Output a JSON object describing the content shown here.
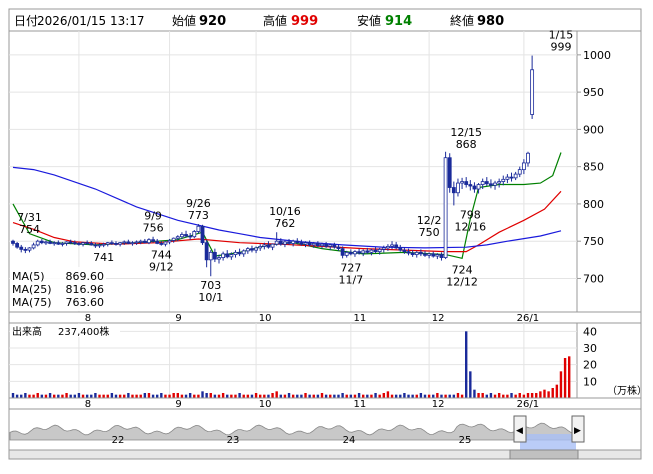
{
  "header": {
    "date_label": "日付",
    "date": "2026/01/15 13:17",
    "open_label": "始値",
    "open": "920",
    "high_label": "高値",
    "high": "999",
    "low_label": "安値",
    "low": "914",
    "close_label": "終値",
    "close": "980",
    "colors": {
      "high": "#e00000",
      "low": "#008000",
      "normal": "#000000"
    }
  },
  "chart_data": {
    "type": "candlestick",
    "price_axis": {
      "ticks": [
        700,
        750,
        800,
        850,
        900,
        950,
        1000
      ],
      "range": [
        655,
        1032
      ]
    },
    "x_axis_months": [
      "8",
      "9",
      "10",
      "11",
      "12",
      "26/1"
    ],
    "month_starts": [
      16,
      38,
      59,
      82,
      101,
      124
    ],
    "annotations": [
      {
        "i": 4,
        "price": 754,
        "date": "7/31",
        "value": "754",
        "pos": "above"
      },
      {
        "i": 22,
        "price": 741,
        "date": "",
        "value": "741",
        "pos": "below-partial"
      },
      {
        "i": 34,
        "price": 756,
        "date": "9/9",
        "value": "756",
        "pos": "above"
      },
      {
        "i": 36,
        "price": 744,
        "date": "9/12",
        "value": "744",
        "pos": "below"
      },
      {
        "i": 45,
        "price": 773,
        "date": "9/26",
        "value": "773",
        "pos": "above"
      },
      {
        "i": 48,
        "price": 703,
        "date": "10/1",
        "value": "703",
        "pos": "below"
      },
      {
        "i": 66,
        "price": 762,
        "date": "10/16",
        "value": "762",
        "pos": "above"
      },
      {
        "i": 82,
        "price": 727,
        "date": "11/7",
        "value": "727",
        "pos": "below"
      },
      {
        "i": 101,
        "price": 750,
        "date": "12/2",
        "value": "750",
        "pos": "above"
      },
      {
        "i": 109,
        "price": 724,
        "date": "12/12",
        "value": "724",
        "pos": "below"
      },
      {
        "i": 110,
        "price": 868,
        "date": "12/15",
        "value": "868",
        "pos": "above"
      },
      {
        "i": 111,
        "price": 798,
        "date": "12/16",
        "value": "798",
        "pos": "below"
      },
      {
        "i": 133,
        "price": 999,
        "date": "1/15",
        "value": "999",
        "pos": "above"
      }
    ],
    "moving_averages": [
      {
        "name": "MA(5)",
        "value": "869.60",
        "color": "#008000",
        "points": [
          [
            0,
            800
          ],
          [
            4,
            760
          ],
          [
            10,
            748
          ],
          [
            20,
            745
          ],
          [
            30,
            748
          ],
          [
            40,
            752
          ],
          [
            46,
            762
          ],
          [
            49,
            730
          ],
          [
            55,
            735
          ],
          [
            62,
            745
          ],
          [
            68,
            748
          ],
          [
            75,
            740
          ],
          [
            85,
            733
          ],
          [
            95,
            735
          ],
          [
            105,
            732
          ],
          [
            109,
            727
          ],
          [
            111,
            780
          ],
          [
            113,
            822
          ],
          [
            118,
            826
          ],
          [
            124,
            826
          ],
          [
            128,
            828
          ],
          [
            131,
            838
          ],
          [
            133,
            869
          ]
        ]
      },
      {
        "name": "MA(25)",
        "value": "816.96",
        "color": "#e00000",
        "points": [
          [
            0,
            775
          ],
          [
            5,
            766
          ],
          [
            10,
            755
          ],
          [
            15,
            749
          ],
          [
            25,
            746
          ],
          [
            35,
            748
          ],
          [
            45,
            753
          ],
          [
            55,
            748
          ],
          [
            65,
            746
          ],
          [
            75,
            743
          ],
          [
            85,
            740
          ],
          [
            95,
            738
          ],
          [
            105,
            736
          ],
          [
            110,
            736
          ],
          [
            113,
            745
          ],
          [
            118,
            762
          ],
          [
            124,
            778
          ],
          [
            129,
            793
          ],
          [
            133,
            817
          ]
        ]
      },
      {
        "name": "MA(75)",
        "value": "763.60",
        "color": "#1a1adc",
        "points": [
          [
            0,
            849
          ],
          [
            5,
            846
          ],
          [
            10,
            839
          ],
          [
            20,
            820
          ],
          [
            30,
            796
          ],
          [
            40,
            778
          ],
          [
            50,
            765
          ],
          [
            55,
            760
          ],
          [
            60,
            755
          ],
          [
            70,
            749
          ],
          [
            80,
            745
          ],
          [
            90,
            742
          ],
          [
            100,
            741
          ],
          [
            110,
            742
          ],
          [
            115,
            745
          ],
          [
            120,
            750
          ],
          [
            128,
            757
          ],
          [
            133,
            764
          ]
        ]
      }
    ],
    "candles": [
      [
        750,
        752,
        744,
        747
      ],
      [
        747,
        749,
        740,
        742
      ],
      [
        742,
        745,
        735,
        739
      ],
      [
        739,
        742,
        734,
        738
      ],
      [
        738,
        742,
        735,
        741
      ],
      [
        741,
        748,
        739,
        745
      ],
      [
        745,
        752,
        743,
        750
      ],
      [
        750,
        753,
        746,
        748
      ],
      [
        748,
        751,
        745,
        749
      ],
      [
        749,
        752,
        746,
        747
      ],
      [
        747,
        750,
        744,
        748
      ],
      [
        748,
        751,
        745,
        746
      ],
      [
        746,
        749,
        743,
        747
      ],
      [
        747,
        750,
        744,
        749
      ],
      [
        749,
        752,
        746,
        748
      ],
      [
        748,
        751,
        745,
        747
      ],
      [
        747,
        749,
        744,
        746
      ],
      [
        746,
        749,
        743,
        748
      ],
      [
        748,
        751,
        745,
        747
      ],
      [
        747,
        750,
        744,
        745
      ],
      [
        745,
        748,
        741,
        744
      ],
      [
        744,
        747,
        741,
        745
      ],
      [
        745,
        748,
        742,
        746
      ],
      [
        746,
        749,
        743,
        748
      ],
      [
        748,
        751,
        745,
        747
      ],
      [
        747,
        750,
        744,
        746
      ],
      [
        746,
        749,
        743,
        748
      ],
      [
        748,
        751,
        745,
        749
      ],
      [
        749,
        752,
        746,
        747
      ],
      [
        747,
        750,
        744,
        748
      ],
      [
        748,
        751,
        745,
        749
      ],
      [
        749,
        752,
        746,
        750
      ],
      [
        750,
        753,
        747,
        748
      ],
      [
        748,
        754,
        746,
        752
      ],
      [
        752,
        756,
        748,
        750
      ],
      [
        750,
        753,
        746,
        747
      ],
      [
        747,
        750,
        744,
        746
      ],
      [
        746,
        750,
        743,
        749
      ],
      [
        749,
        753,
        746,
        751
      ],
      [
        751,
        755,
        748,
        754
      ],
      [
        754,
        758,
        750,
        756
      ],
      [
        756,
        762,
        753,
        759
      ],
      [
        759,
        764,
        755,
        757
      ],
      [
        757,
        761,
        752,
        756
      ],
      [
        756,
        765,
        754,
        763
      ],
      [
        763,
        773,
        760,
        770
      ],
      [
        770,
        772,
        745,
        748
      ],
      [
        748,
        752,
        715,
        725
      ],
      [
        725,
        738,
        703,
        735
      ],
      [
        735,
        740,
        722,
        726
      ],
      [
        726,
        732,
        720,
        728
      ],
      [
        728,
        736,
        724,
        733
      ],
      [
        733,
        738,
        727,
        729
      ],
      [
        729,
        735,
        725,
        732
      ],
      [
        732,
        738,
        728,
        735
      ],
      [
        735,
        740,
        730,
        733
      ],
      [
        733,
        739,
        729,
        737
      ],
      [
        737,
        742,
        733,
        740
      ],
      [
        740,
        744,
        735,
        738
      ],
      [
        738,
        743,
        734,
        741
      ],
      [
        741,
        746,
        737,
        743
      ],
      [
        743,
        748,
        739,
        745
      ],
      [
        745,
        750,
        740,
        742
      ],
      [
        742,
        747,
        738,
        746
      ],
      [
        746,
        762,
        744,
        750
      ],
      [
        750,
        754,
        744,
        746
      ],
      [
        746,
        751,
        742,
        749
      ],
      [
        749,
        753,
        745,
        747
      ],
      [
        747,
        752,
        743,
        750
      ],
      [
        750,
        754,
        746,
        748
      ],
      [
        748,
        752,
        744,
        746
      ],
      [
        746,
        750,
        742,
        748
      ],
      [
        748,
        751,
        743,
        745
      ],
      [
        745,
        749,
        741,
        747
      ],
      [
        747,
        750,
        742,
        744
      ],
      [
        744,
        748,
        740,
        746
      ],
      [
        746,
        749,
        741,
        743
      ],
      [
        743,
        747,
        738,
        745
      ],
      [
        745,
        748,
        740,
        742
      ],
      [
        742,
        746,
        737,
        740
      ],
      [
        740,
        743,
        727,
        731
      ],
      [
        731,
        737,
        728,
        735
      ],
      [
        735,
        739,
        731,
        733
      ],
      [
        733,
        738,
        729,
        736
      ],
      [
        736,
        740,
        732,
        734
      ],
      [
        734,
        739,
        730,
        737
      ],
      [
        737,
        741,
        733,
        735
      ],
      [
        735,
        740,
        731,
        738
      ],
      [
        738,
        742,
        734,
        736
      ],
      [
        736,
        741,
        732,
        739
      ],
      [
        739,
        744,
        735,
        741
      ],
      [
        741,
        746,
        737,
        743
      ],
      [
        743,
        750,
        739,
        745
      ],
      [
        745,
        749,
        739,
        741
      ],
      [
        741,
        745,
        736,
        738
      ],
      [
        738,
        742,
        733,
        736
      ],
      [
        736,
        740,
        731,
        734
      ],
      [
        734,
        738,
        729,
        732
      ],
      [
        732,
        737,
        728,
        735
      ],
      [
        735,
        739,
        730,
        733
      ],
      [
        733,
        737,
        729,
        731
      ],
      [
        731,
        735,
        727,
        733
      ],
      [
        733,
        736,
        728,
        730
      ],
      [
        730,
        734,
        726,
        732
      ],
      [
        732,
        735,
        724,
        728
      ],
      [
        728,
        870,
        726,
        862
      ],
      [
        862,
        868,
        815,
        822
      ],
      [
        822,
        830,
        798,
        815
      ],
      [
        815,
        834,
        810,
        828
      ],
      [
        828,
        835,
        820,
        830
      ],
      [
        830,
        836,
        822,
        826
      ],
      [
        826,
        832,
        818,
        824
      ],
      [
        824,
        829,
        815,
        820
      ],
      [
        820,
        828,
        814,
        826
      ],
      [
        826,
        834,
        820,
        830
      ],
      [
        830,
        836,
        824,
        827
      ],
      [
        827,
        833,
        821,
        825
      ],
      [
        825,
        831,
        819,
        828
      ],
      [
        828,
        834,
        822,
        830
      ],
      [
        830,
        838,
        825,
        833
      ],
      [
        833,
        840,
        828,
        836
      ],
      [
        836,
        842,
        830,
        835
      ],
      [
        835,
        843,
        832,
        840
      ],
      [
        840,
        850,
        836,
        846
      ],
      [
        846,
        860,
        840,
        855
      ],
      [
        855,
        870,
        850,
        868
      ],
      [
        920,
        999,
        914,
        980
      ]
    ],
    "volume": {
      "axis_label": "出来高",
      "current": "237,400株",
      "unit": "（万株）",
      "ticks": [
        10,
        20,
        30,
        40
      ],
      "range_max": 45,
      "values_10k_shares": [
        3,
        2,
        2,
        3,
        2,
        2,
        3,
        2,
        2,
        3,
        2,
        2,
        2,
        3,
        2,
        2,
        3,
        2,
        2,
        2,
        3,
        2,
        2,
        2,
        3,
        2,
        2,
        2,
        3,
        2,
        2,
        2,
        3,
        3,
        2,
        2,
        3,
        2,
        2,
        3,
        3,
        2,
        2,
        3,
        2,
        2,
        4,
        3,
        3,
        2,
        2,
        3,
        2,
        2,
        2,
        3,
        2,
        2,
        2,
        3,
        2,
        2,
        2,
        3,
        4,
        2,
        2,
        3,
        2,
        2,
        2,
        3,
        2,
        2,
        2,
        3,
        2,
        2,
        2,
        2,
        3,
        2,
        2,
        2,
        3,
        2,
        2,
        2,
        3,
        2,
        3,
        4,
        2,
        2,
        2,
        3,
        2,
        2,
        2,
        3,
        2,
        2,
        2,
        3,
        2,
        2,
        2,
        2,
        3,
        2,
        40,
        16,
        5,
        3,
        3,
        2,
        3,
        2,
        3,
        2,
        2,
        3,
        2,
        3,
        2,
        3,
        3,
        3,
        4,
        5,
        4,
        6,
        8,
        16,
        24,
        25
      ]
    }
  },
  "overview": {
    "labels": [
      "22",
      "23",
      "24",
      "25"
    ],
    "left_handle": "◀",
    "right_handle": "▶"
  }
}
